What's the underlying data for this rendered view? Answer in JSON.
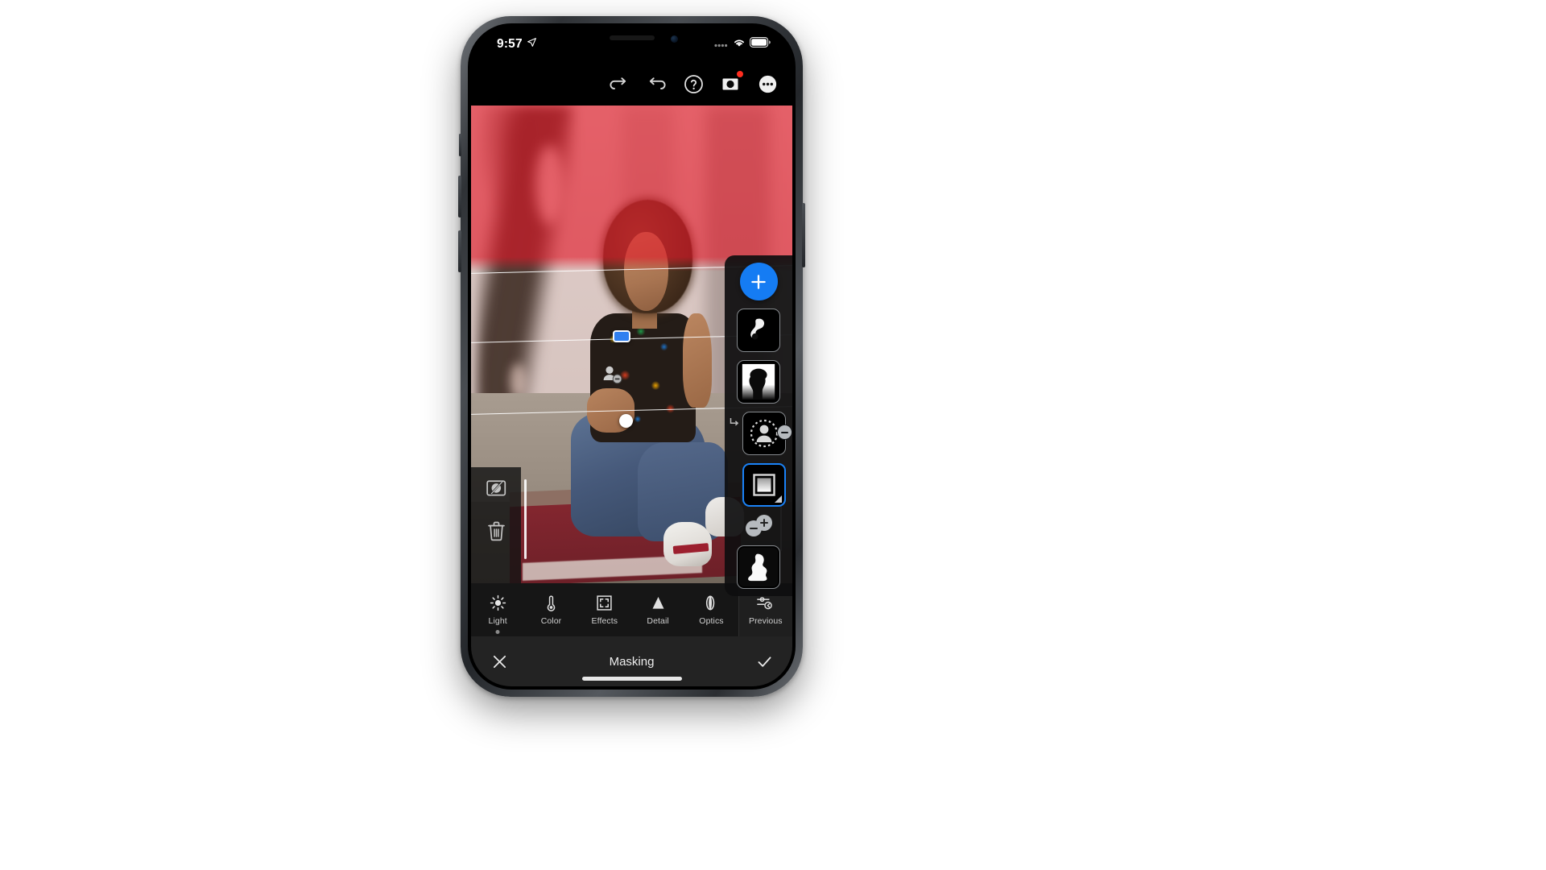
{
  "status_bar": {
    "time": "9:57",
    "location_icon": "location-arrow-icon",
    "wifi_icon": "wifi-icon",
    "battery_icon": "battery-icon",
    "signal_icon": "cellular-signal-icon"
  },
  "top_toolbar": {
    "items": [
      {
        "name": "redo-button",
        "icon": "redo-arrow-icon"
      },
      {
        "name": "undo-button",
        "icon": "undo-arrow-icon"
      },
      {
        "name": "help-button",
        "icon": "question-mark-circle-icon"
      },
      {
        "name": "camera-button",
        "icon": "camera-icon",
        "badge": true
      },
      {
        "name": "more-options-button",
        "icon": "ellipsis-circle-icon"
      }
    ]
  },
  "photo_overlay": {
    "invert_mask_label": "invert-mask-icon",
    "delete_mask_label": "trash-icon",
    "gradient_center_handle": "linear-gradient-center-handle",
    "gradient_bottom_handle": "linear-gradient-feather-handle",
    "subject_subtract_pin": "subject-subtract-pin",
    "mask_overlay_color": "#E21626"
  },
  "mask_panel": {
    "add_mask_label": "+",
    "masks": [
      {
        "name": "mask-thumb-1",
        "type": "brush-mask",
        "selected": false,
        "sub": false
      },
      {
        "name": "mask-thumb-2",
        "type": "subject-mask",
        "selected": false,
        "sub": false
      },
      {
        "name": "mask-thumb-3",
        "type": "subject-subtract-mask",
        "selected": false,
        "sub": true
      },
      {
        "name": "mask-thumb-4",
        "type": "linear-gradient-mask",
        "selected": true,
        "sub": true
      },
      {
        "name": "mask-thumb-5",
        "type": "subject-silhouette-mask",
        "selected": false,
        "sub": false
      }
    ],
    "add_small_label": "add-mask-small-button",
    "subtract_small_label": "subtract-mask-small-button",
    "accent_color": "#157CF3"
  },
  "edit_toolbar": {
    "items": [
      {
        "label": "Light",
        "icon": "sun-icon",
        "active": true
      },
      {
        "label": "Color",
        "icon": "thermometer-icon",
        "active": false
      },
      {
        "label": "Effects",
        "icon": "crop-brackets-icon",
        "active": false
      },
      {
        "label": "Detail",
        "icon": "triangle-icon",
        "active": false
      },
      {
        "label": "Optics",
        "icon": "lens-icon",
        "active": false
      },
      {
        "label": "Previous",
        "icon": "sliders-back-icon",
        "active": false
      }
    ]
  },
  "bottom_bar": {
    "title": "Masking",
    "cancel_icon": "close-x-icon",
    "confirm_icon": "checkmark-icon"
  }
}
